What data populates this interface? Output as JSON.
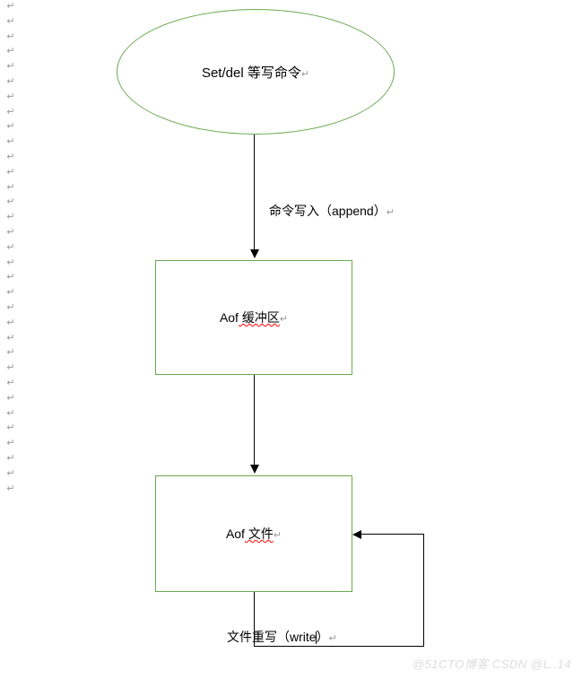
{
  "diagram": {
    "ellipse": {
      "text": "Set/del 等写命令",
      "ret": "↵"
    },
    "arrow1_label": {
      "text": "命令写入（append）",
      "ret": "↵"
    },
    "box1": {
      "prefix": "Aof",
      "underlined": " 缓冲区",
      "ret": "↵"
    },
    "box2": {
      "prefix": "Aof",
      "underlined": " 文件",
      "ret": "↵"
    },
    "rewrite_label": {
      "text": "文件重写（write",
      "after": "）",
      "ret": "↵"
    }
  },
  "chart_data": {
    "type": "diagram",
    "nodes": [
      {
        "id": "n1",
        "shape": "ellipse",
        "label": "Set/del 等写命令"
      },
      {
        "id": "n2",
        "shape": "rect",
        "label": "Aof 缓冲区"
      },
      {
        "id": "n3",
        "shape": "rect",
        "label": "Aof 文件"
      }
    ],
    "edges": [
      {
        "from": "n1",
        "to": "n2",
        "label": "命令写入（append）"
      },
      {
        "from": "n2",
        "to": "n3",
        "label": ""
      },
      {
        "from": "n3",
        "to": "n3",
        "label": "文件重写（write）"
      }
    ]
  },
  "margin_marks": {
    "symbol": "↵",
    "count": 33
  },
  "watermark": {
    "text": "@51CTO博客 CSDN @L..14"
  }
}
